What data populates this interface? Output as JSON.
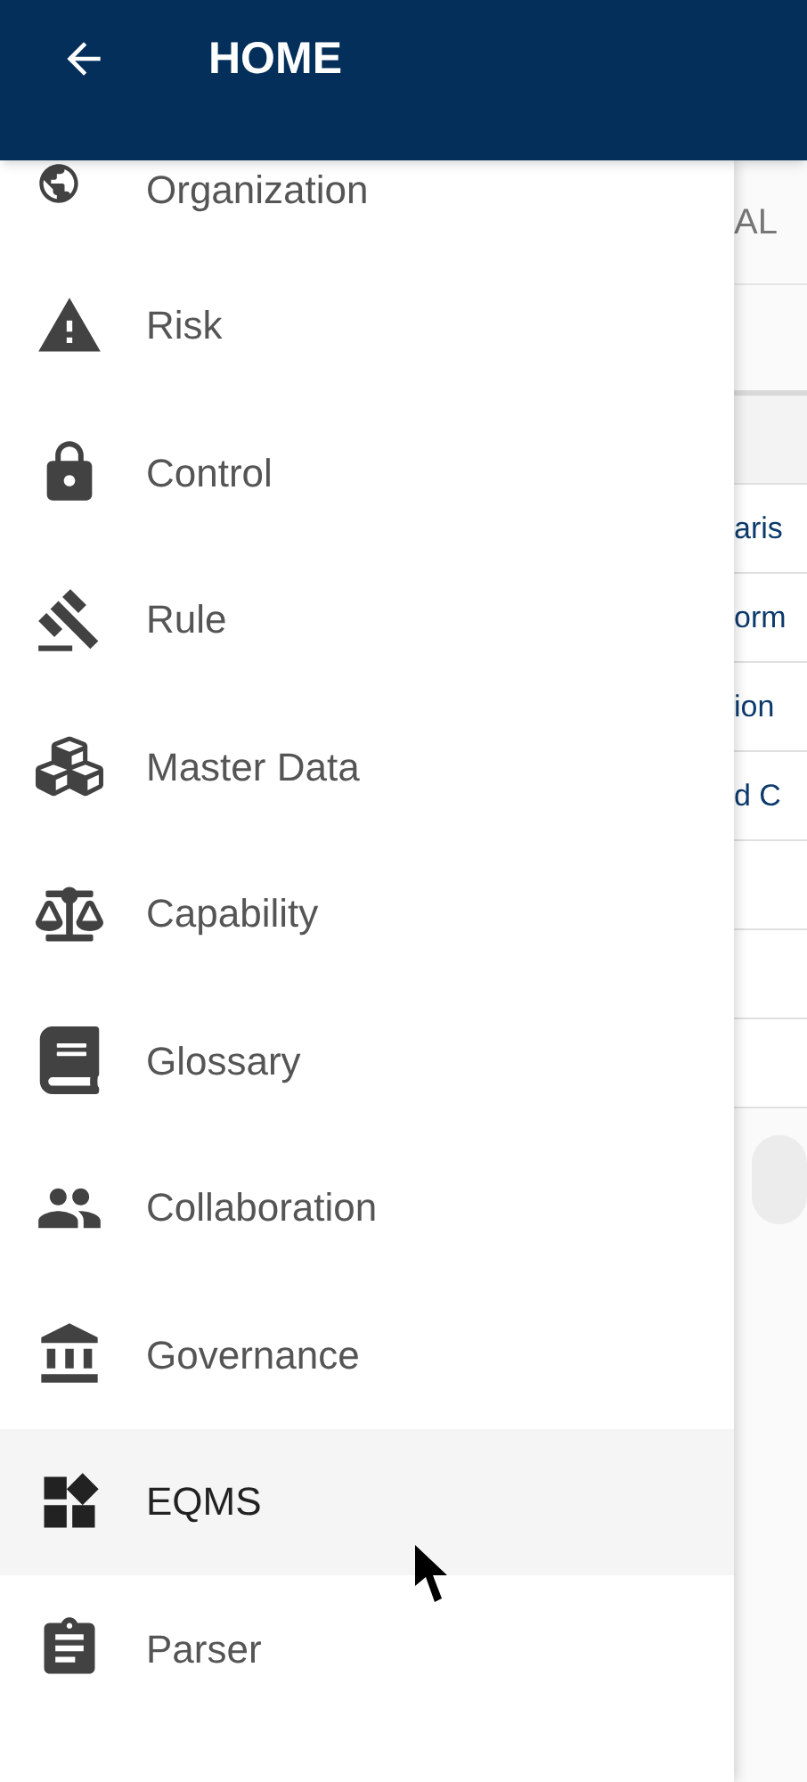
{
  "header": {
    "title": "HOME"
  },
  "drawer": {
    "items": [
      {
        "label": "Organization",
        "selected": false
      },
      {
        "label": "Risk",
        "selected": false
      },
      {
        "label": "Control",
        "selected": false
      },
      {
        "label": "Rule",
        "selected": false
      },
      {
        "label": "Master Data",
        "selected": false
      },
      {
        "label": "Capability",
        "selected": false
      },
      {
        "label": "Glossary",
        "selected": false
      },
      {
        "label": "Collaboration",
        "selected": false
      },
      {
        "label": "Governance",
        "selected": false
      },
      {
        "label": "EQMS",
        "selected": true
      },
      {
        "label": "Parser",
        "selected": false
      }
    ]
  },
  "background": {
    "tab": "AL",
    "rows": [
      "aris",
      "orm",
      "ion",
      "d C"
    ]
  }
}
